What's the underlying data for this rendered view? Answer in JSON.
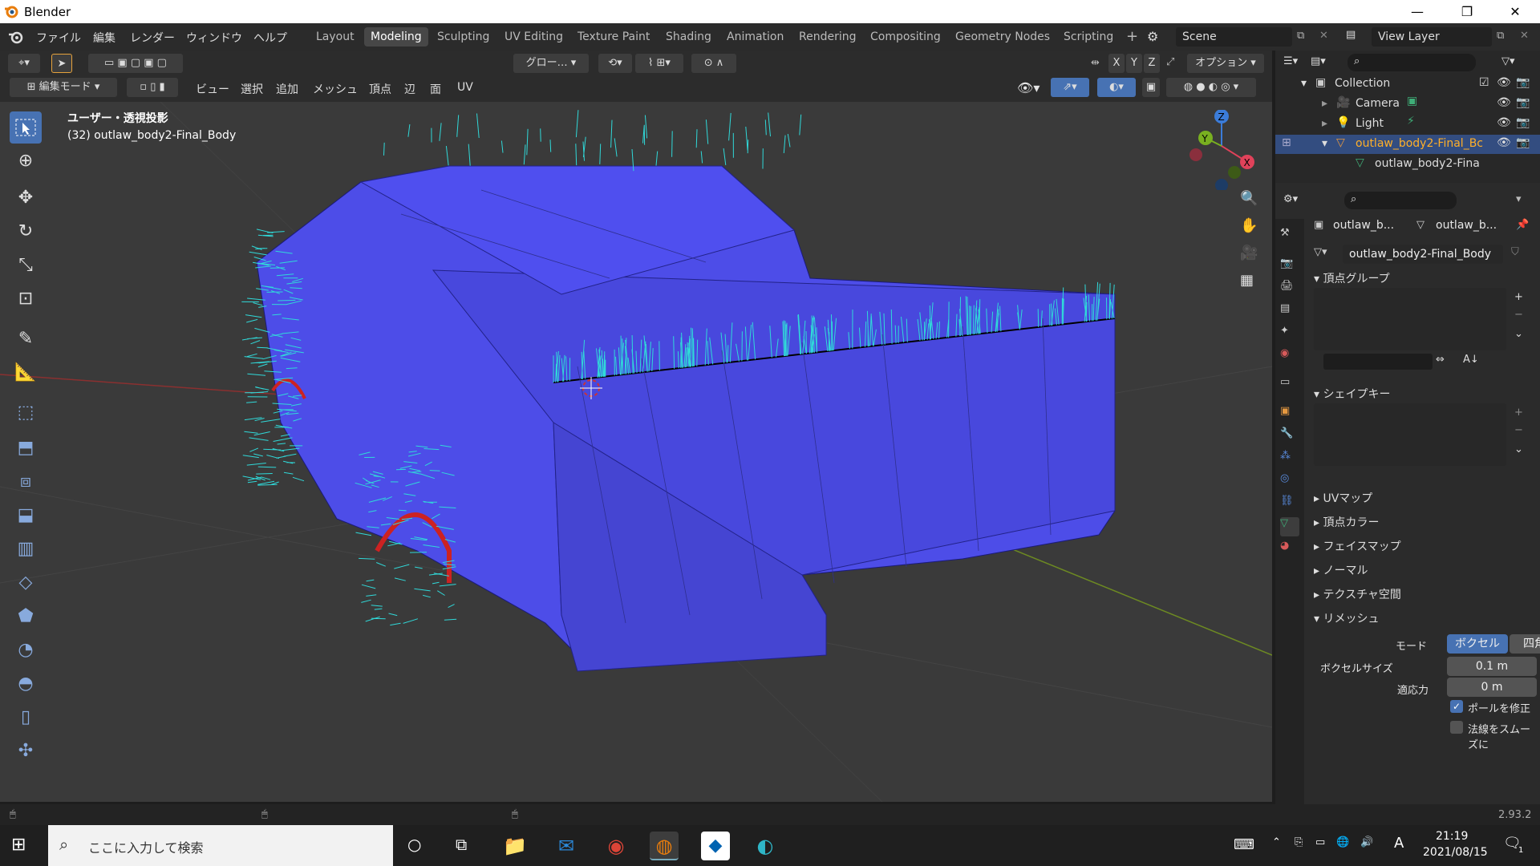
{
  "window": {
    "title": "Blender",
    "minimize": "—",
    "maximize": "❐",
    "close": "✕"
  },
  "top_menu": [
    "ファイル",
    "編集",
    "レンダー",
    "ウィンドウ",
    "ヘルプ"
  ],
  "workspaces": [
    "Layout",
    "Modeling",
    "Sculpting",
    "UV Editing",
    "Texture Paint",
    "Shading",
    "Animation",
    "Rendering",
    "Compositing",
    "Geometry Nodes",
    "Scripting"
  ],
  "active_workspace": "Modeling",
  "scene": {
    "name": "Scene",
    "view_layer": "View Layer"
  },
  "header": {
    "mode": "編集モード",
    "menus": [
      "ビュー",
      "選択",
      "追加",
      "メッシュ",
      "頂点",
      "辺",
      "面",
      "UV"
    ],
    "transform_orientation": "グロー…",
    "options": "オプション",
    "axes": [
      "X",
      "Y",
      "Z"
    ]
  },
  "viewport": {
    "view_label": "ユーザー・透視投影",
    "object_label": "(32) outlaw_body2-Final_Body",
    "gizmo_axes": {
      "z": "Z",
      "y": "Y",
      "x": "X"
    }
  },
  "outliner": {
    "collection": "Collection",
    "items": [
      {
        "name": "Camera"
      },
      {
        "name": "Light"
      },
      {
        "name": "outlaw_body2-Final_Bc"
      },
      {
        "name": "outlaw_body2-Fina"
      }
    ]
  },
  "properties": {
    "breadcrumb_obj": "outlaw_b...",
    "breadcrumb_mesh": "outlaw_b...",
    "mesh_name": "outlaw_body2-Final_Body",
    "sections": {
      "vertex_groups": "頂点グループ",
      "shape_keys": "シェイプキー",
      "uv_maps": "UVマップ",
      "vertex_colors": "頂点カラー",
      "face_maps": "フェイスマップ",
      "normals": "ノーマル",
      "texture_space": "テクスチャ空間",
      "remesh": "リメッシュ"
    },
    "remesh": {
      "mode_label": "モード",
      "mode_voxel": "ボクセル",
      "mode_quad": "四角面",
      "voxel_size_label": "ボクセルサイズ",
      "voxel_size": "0.1 m",
      "adaptivity_label": "適応力",
      "adaptivity": "0 m",
      "fix_poles": "ポールを修正",
      "fix_poles_checked": true,
      "smooth_normals": "法線をスムーズに",
      "smooth_normals_checked": false
    }
  },
  "status": {
    "version": "2.93.2"
  },
  "taskbar": {
    "search_placeholder": "ここに入力して検索",
    "time": "21:19",
    "date": "2021/08/15",
    "ime": "A",
    "notifications": "1"
  },
  "colors": {
    "accent": "#4772b3",
    "mesh_face": "#4d4de8",
    "normals": "#30d9d9",
    "viewport_bg": "#3a3a3a"
  }
}
